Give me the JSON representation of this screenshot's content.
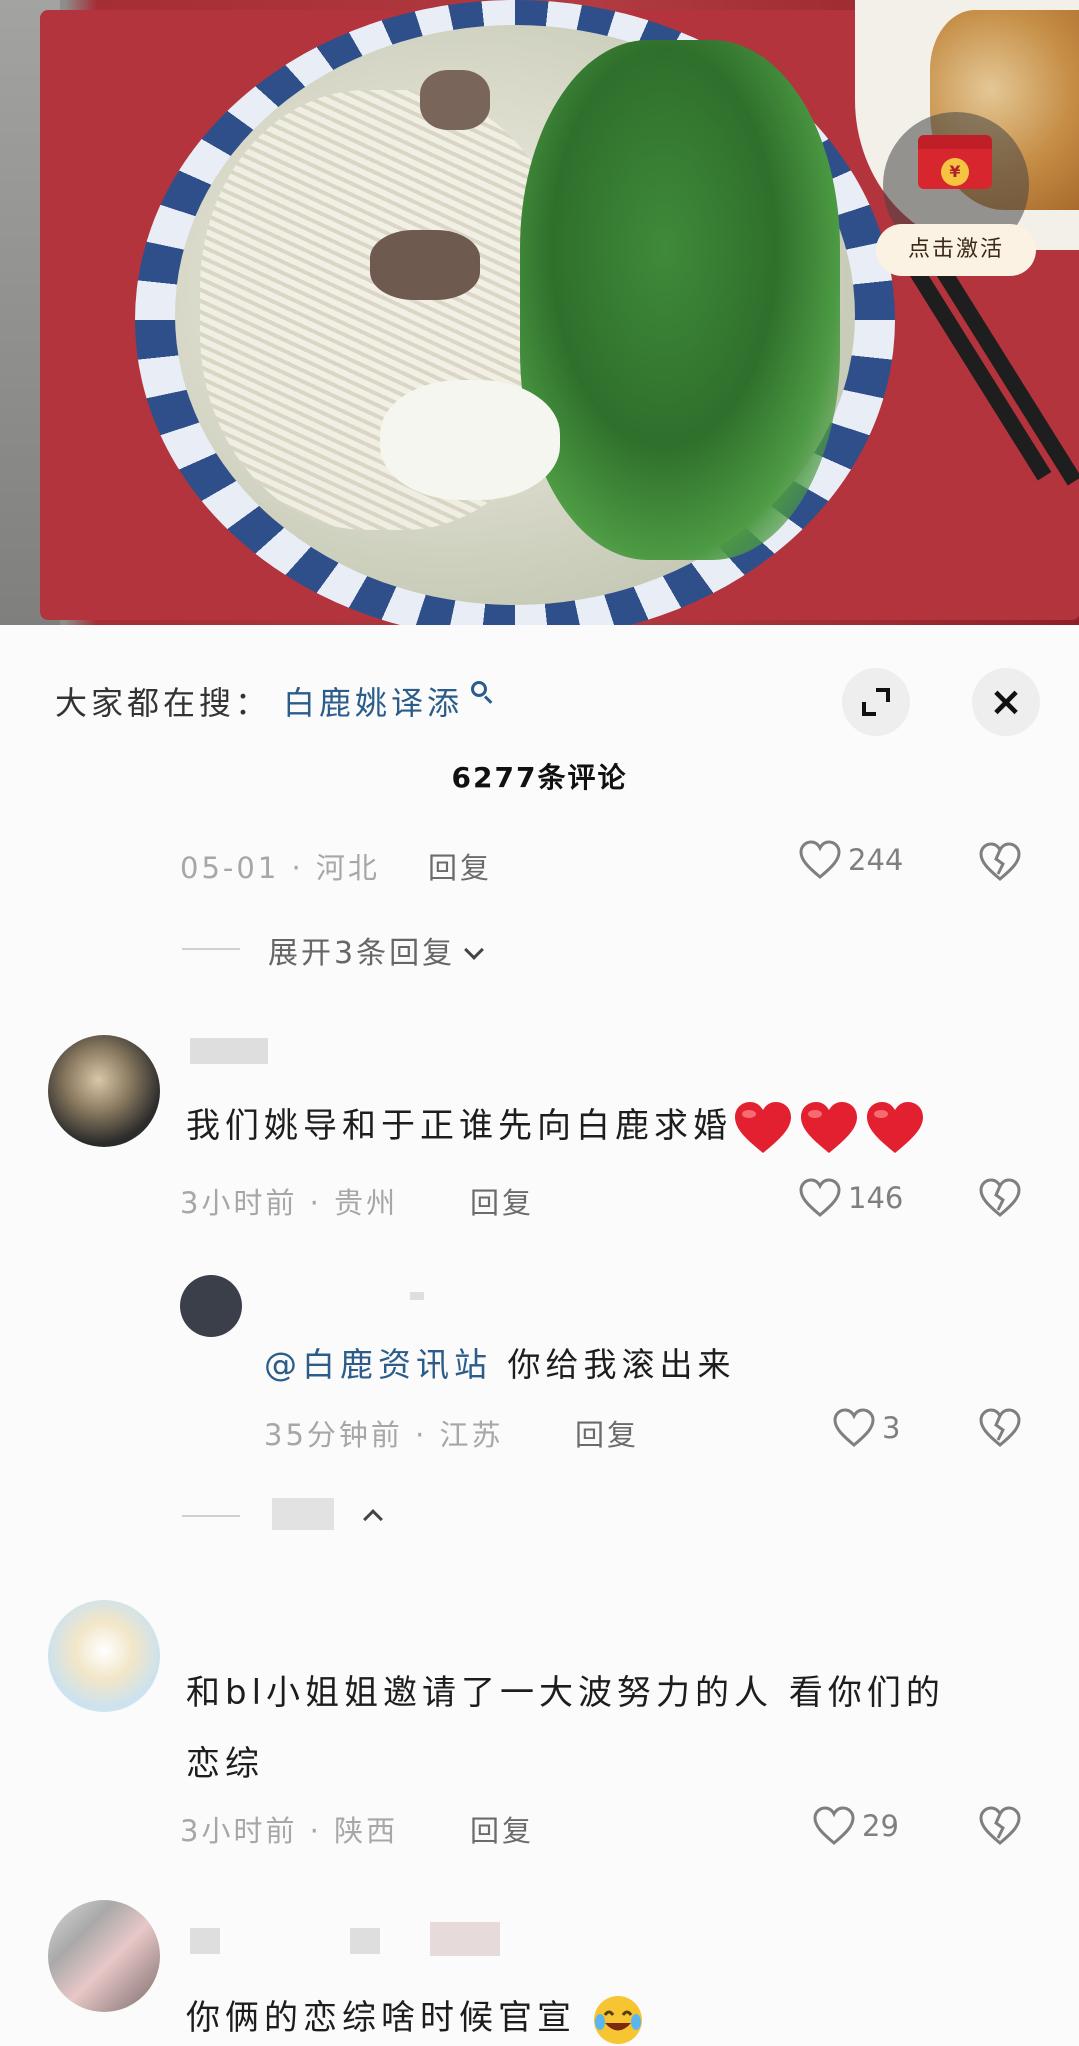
{
  "video": {
    "red_packet_icon": "red-envelope-icon",
    "red_packet_coin": "¥",
    "red_packet_label": "点击激活"
  },
  "sheet": {
    "search_prefix": "大家都在搜：",
    "search_term": "白鹿姚译添",
    "comment_count": "6277条评论"
  },
  "thread1": {
    "meta": "05-01 · 河北",
    "reply": "回复",
    "likes": "244",
    "expand": "展开3条回复"
  },
  "comment1": {
    "text": "我们姚导和于正谁先向白鹿求婚",
    "emoji": "heart-emoji",
    "meta": "3小时前 · 贵州",
    "reply": "回复",
    "likes": "146"
  },
  "reply1": {
    "mention": "@白鹿资讯站",
    "text": " 你给我滚出来",
    "meta": "35分钟前 · 江苏",
    "reply": "回复",
    "likes": "3"
  },
  "comment2": {
    "line1": "和bl小姐姐邀请了一大波努力的人 看你们的",
    "line2": "恋综",
    "meta": "3小时前 · 陕西",
    "reply": "回复",
    "likes": "29"
  },
  "comment3": {
    "text": "你俩的恋综啥时候官宣",
    "emoji": "laughing-crying-emoji"
  },
  "colors": {
    "link": "#2b5c8a",
    "meta": "#a7a7a7",
    "heart_emoji": "#e3202f"
  }
}
